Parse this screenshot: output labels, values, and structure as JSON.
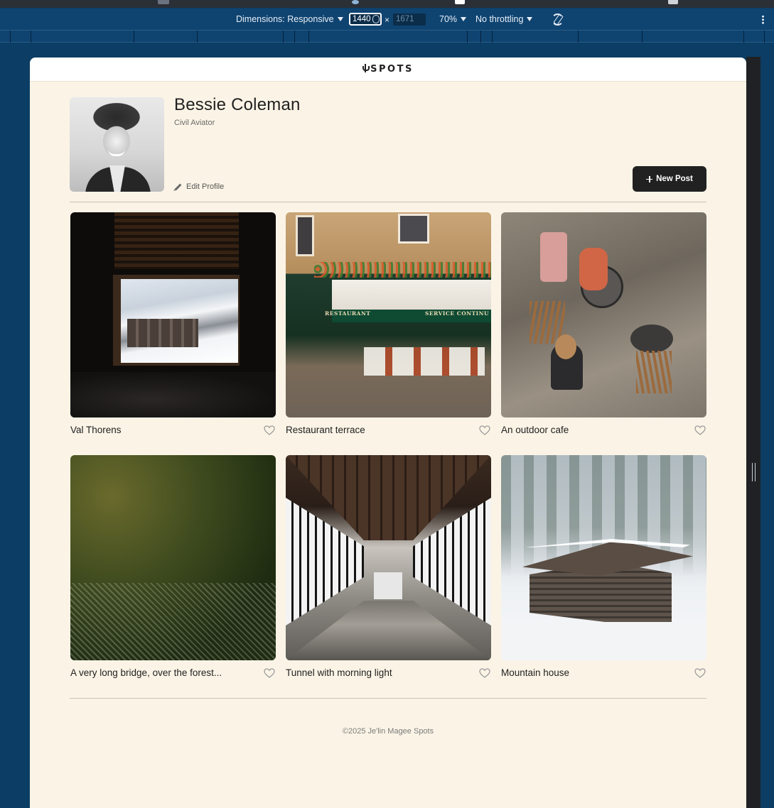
{
  "devtools": {
    "dimensions_label": "Dimensions: Responsive",
    "width_value": "1440",
    "height_value": "1671",
    "zoom": "70%",
    "throttling": "No throttling"
  },
  "app": {
    "logo_text": "SPOTS"
  },
  "profile": {
    "name": "Bessie Coleman",
    "role": "Civil Aviator",
    "edit_label": "Edit Profile",
    "new_post_label": "New Post"
  },
  "cards": [
    {
      "title": "Val Thorens",
      "photo": "window-snow-village"
    },
    {
      "title": "Restaurant terrace",
      "photo": "restaurant-terrace",
      "sign_left": "RESTAURANT",
      "sign_right": "SERVICE CONTINU"
    },
    {
      "title": "An outdoor cafe",
      "photo": "outdoor-cafe"
    },
    {
      "title": "A very long bridge, over the forest...",
      "photo": "suspension-bridge"
    },
    {
      "title": "Tunnel with morning light",
      "photo": "tunnel-corridor"
    },
    {
      "title": "Mountain house",
      "photo": "snowy-cabin"
    }
  ],
  "footer": {
    "text": "©2025 Je'lin Magee Spots"
  },
  "colors": {
    "page_bg": "#fbf4e6",
    "devtools_bg": "#0f4471",
    "button_bg": "#212121"
  },
  "icons": [
    "heart-icon",
    "pencil-icon",
    "plus-icon",
    "rotate-icon",
    "more-icon",
    "spots-logo-icon"
  ]
}
